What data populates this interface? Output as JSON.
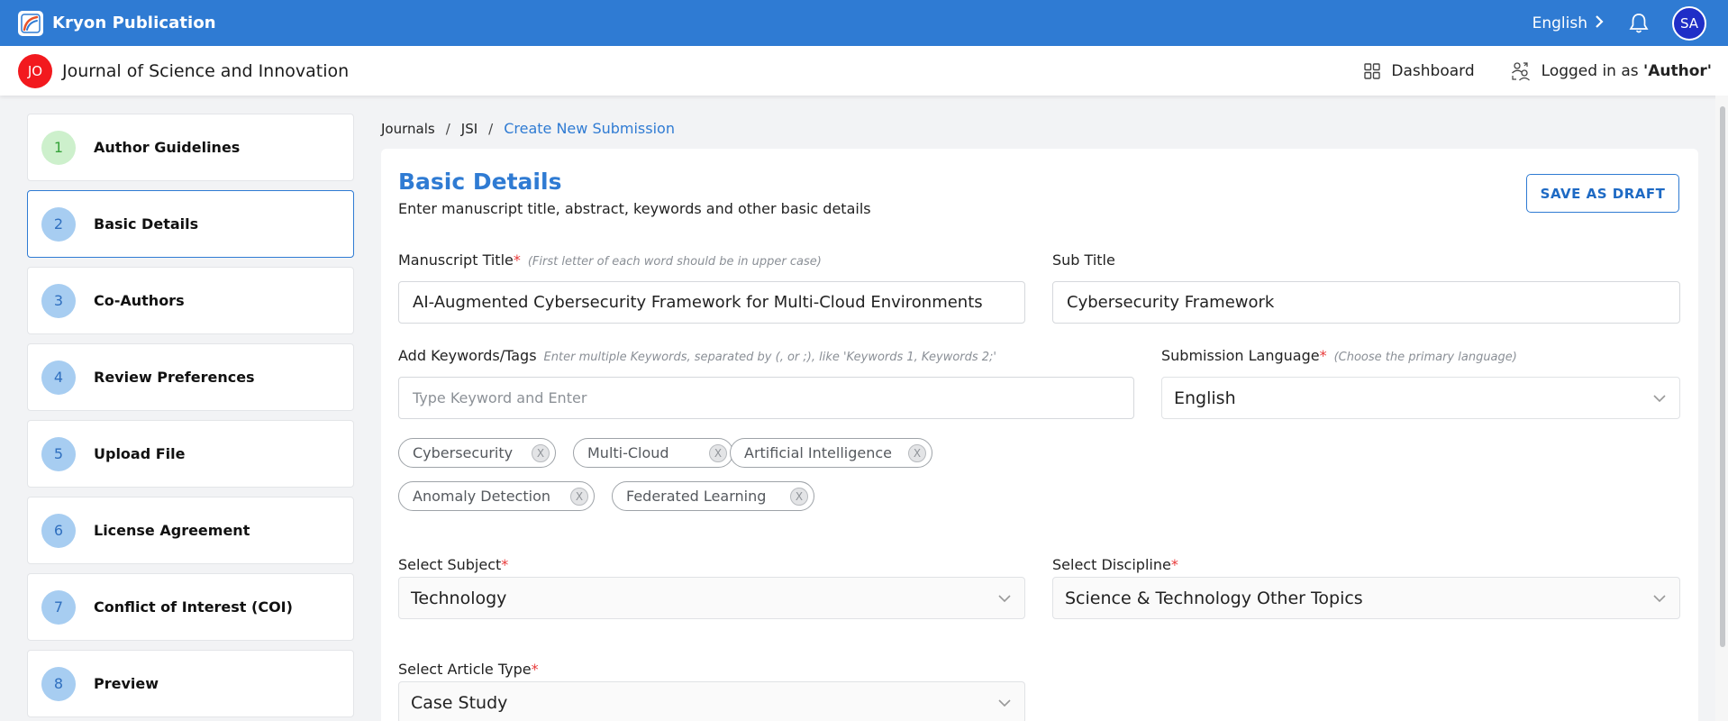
{
  "app": {
    "name": "Kryon Publication"
  },
  "topbar": {
    "language": "English",
    "avatar_initials": "SA"
  },
  "journal": {
    "badge": "JO",
    "title": "Journal of Science and Innovation"
  },
  "nav": {
    "dashboard": "Dashboard",
    "logged_in_prefix": "Logged in as ",
    "role": "'Author'"
  },
  "sidebar": {
    "steps": [
      {
        "num": "1",
        "label": "Author Guidelines",
        "state": "done"
      },
      {
        "num": "2",
        "label": "Basic Details",
        "state": "active"
      },
      {
        "num": "3",
        "label": "Co-Authors",
        "state": "pending"
      },
      {
        "num": "4",
        "label": "Review Preferences",
        "state": "pending"
      },
      {
        "num": "5",
        "label": "Upload File",
        "state": "pending"
      },
      {
        "num": "6",
        "label": "License Agreement",
        "state": "pending"
      },
      {
        "num": "7",
        "label": "Conflict of Interest (COI)",
        "state": "pending"
      },
      {
        "num": "8",
        "label": "Preview",
        "state": "pending"
      }
    ]
  },
  "breadcrumb": {
    "items": [
      "Journals",
      "JSI"
    ],
    "current": "Create New Submission"
  },
  "section": {
    "title": "Basic Details",
    "subtitle": "Enter manuscript title, abstract, keywords and other basic details",
    "save_draft": "SAVE AS DRAFT"
  },
  "form": {
    "manuscript_title": {
      "label": "Manuscript Title",
      "required": "*",
      "hint": "(First letter of each word should be in upper case)",
      "value": "AI-Augmented Cybersecurity Framework for Multi-Cloud Environments"
    },
    "sub_title": {
      "label": "Sub Title",
      "value": "Cybersecurity Framework"
    },
    "keywords": {
      "label": "Add Keywords/Tags",
      "hint": "Enter multiple Keywords, separated by (, or ;), like 'Keywords 1, Keywords 2;'",
      "placeholder": "Type Keyword and Enter",
      "tags": [
        "Cybersecurity",
        "Multi-Cloud",
        "Artificial Intelligence",
        "Anomaly Detection",
        "Federated Learning"
      ],
      "remove_glyph": "X"
    },
    "submission_language": {
      "label": "Submission Language",
      "required": "*",
      "hint": "(Choose the primary language)",
      "value": "English"
    },
    "subject": {
      "label": "Select Subject",
      "required": "*",
      "value": "Technology"
    },
    "discipline": {
      "label": "Select Discipline",
      "required": "*",
      "value": "Science & Technology Other Topics"
    },
    "article_type": {
      "label": "Select Article Type",
      "required": "*",
      "value": "Case Study"
    }
  },
  "colors": {
    "primary": "#2f7bd3",
    "required": "#e83a3a",
    "badge_red": "#f2191e",
    "avatar_blue": "#1f2ec7"
  },
  "icons": [
    "kryon-logo-icon",
    "chevron-right-icon",
    "bell-icon",
    "dashboard-grid-icon",
    "user-switch-icon",
    "close-icon",
    "chevron-down-icon"
  ]
}
